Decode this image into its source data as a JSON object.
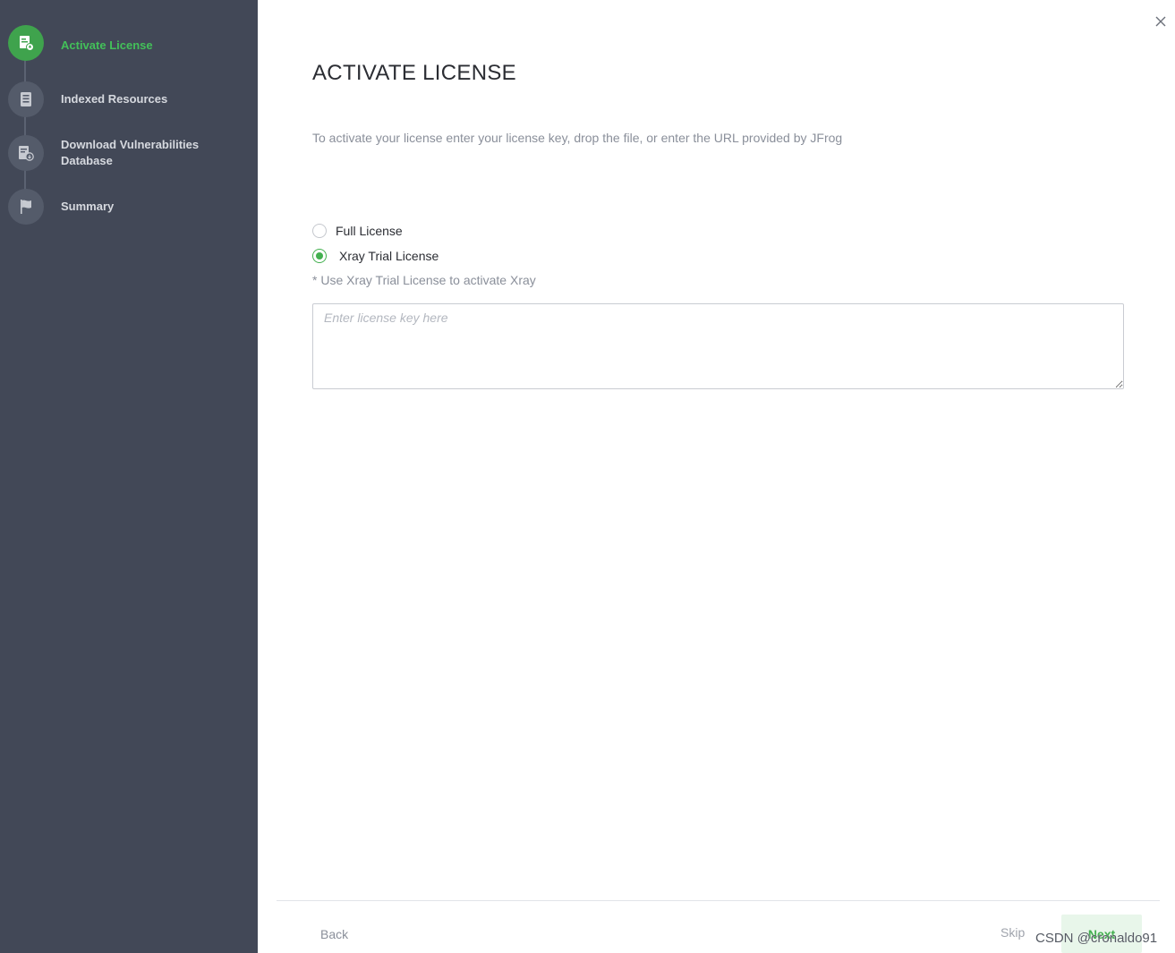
{
  "sidebar": {
    "steps": [
      {
        "label": "Activate License",
        "icon": "license-icon",
        "active": true
      },
      {
        "label": "Indexed Resources",
        "icon": "resources-list-icon",
        "active": false
      },
      {
        "label": "Download Vulnerabilities Database",
        "icon": "database-download-icon",
        "active": false
      },
      {
        "label": "Summary",
        "icon": "flag-icon",
        "active": false
      }
    ]
  },
  "main": {
    "title": "ACTIVATE LICENSE",
    "subtitle": "To activate your license enter your license key, drop the file, or enter the URL provided by JFrog",
    "options": [
      {
        "label": "Full License",
        "checked": false
      },
      {
        "label": "Xray Trial License",
        "checked": true
      }
    ],
    "hint": "* Use Xray Trial License to activate Xray",
    "license_input": {
      "placeholder": "Enter license key here",
      "value": ""
    }
  },
  "footer": {
    "back_label": "Back",
    "skip_label": "Skip",
    "next_label": "Next"
  },
  "watermark": "CSDN @cronaldo91",
  "colors": {
    "sidebar_bg": "#424857",
    "accent_green": "#43b04f",
    "active_step_label": "#43c059"
  }
}
